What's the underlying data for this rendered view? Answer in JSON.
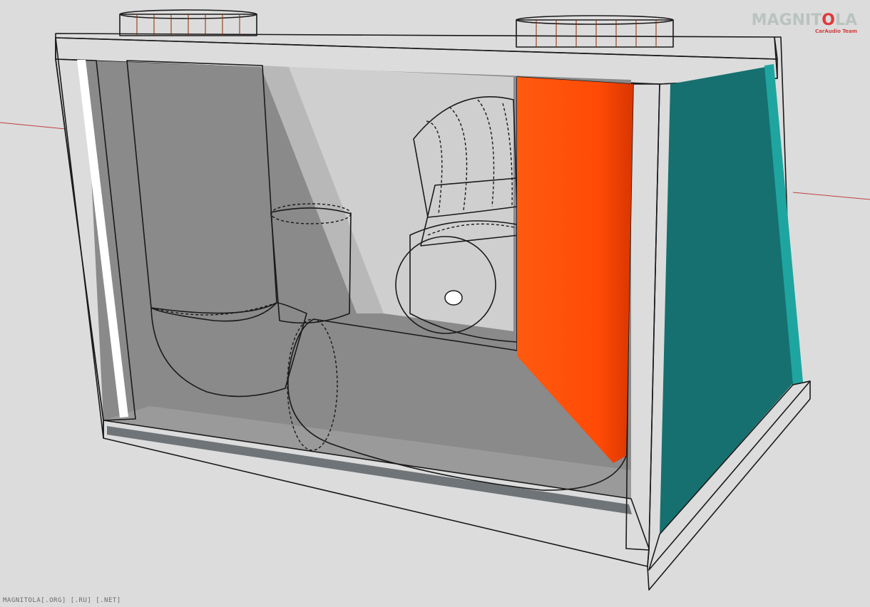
{
  "logo": {
    "brand_prefix": "MAGNIT",
    "brand_o": "O",
    "brand_suffix": "LA",
    "subtitle": "CarAudio Team"
  },
  "footer_text": "MAGNITOLA[.ORG] [.RU] [.NET]",
  "colors": {
    "background": "#dcdcdc",
    "pipe": "#ff4a06",
    "pipe_shadow": "#e23a00",
    "panel_dark": "#5b5b5b",
    "panel_teal": "#16706f",
    "panel_light": "#c9d0d6",
    "interior": "#7d7d7d"
  },
  "icons": [
    "subwoofer-speaker-icon",
    "port-pipe-icon"
  ]
}
